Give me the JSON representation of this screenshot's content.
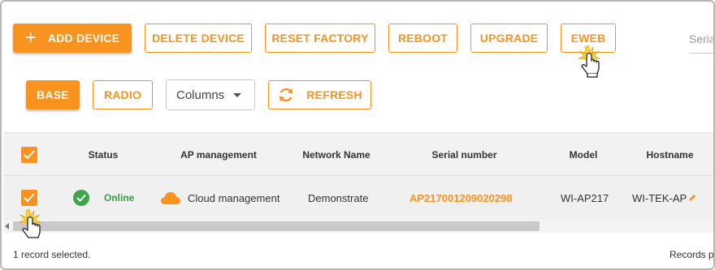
{
  "toolbar": {
    "add_device": "ADD DEVICE",
    "delete_device": "DELETE DEVICE",
    "reset_factory": "RESET FACTORY",
    "reboot": "REBOOT",
    "upgrade": "UPGRADE",
    "eweb": "EWEB",
    "search_placeholder": "Seria"
  },
  "toolbar2": {
    "base": "BASE",
    "radio": "RADIO",
    "columns_select": "Columns",
    "refresh": "REFRESH"
  },
  "table": {
    "columns": [
      "Status",
      "AP management",
      "Network Name",
      "Serial number",
      "Model",
      "Hostname"
    ],
    "rows": [
      {
        "selected": true,
        "status": "Online",
        "ap_management": "Cloud management",
        "network_name": "Demonstrate",
        "serial_number": "AP217001209020298",
        "model": "WI-AP217",
        "hostname": "WI-TEK-AP"
      }
    ]
  },
  "footer": {
    "selected_text": "1 record selected.",
    "records_per_page": "Records pe"
  },
  "colors": {
    "accent": "#f7931e",
    "online": "#3da64a"
  }
}
